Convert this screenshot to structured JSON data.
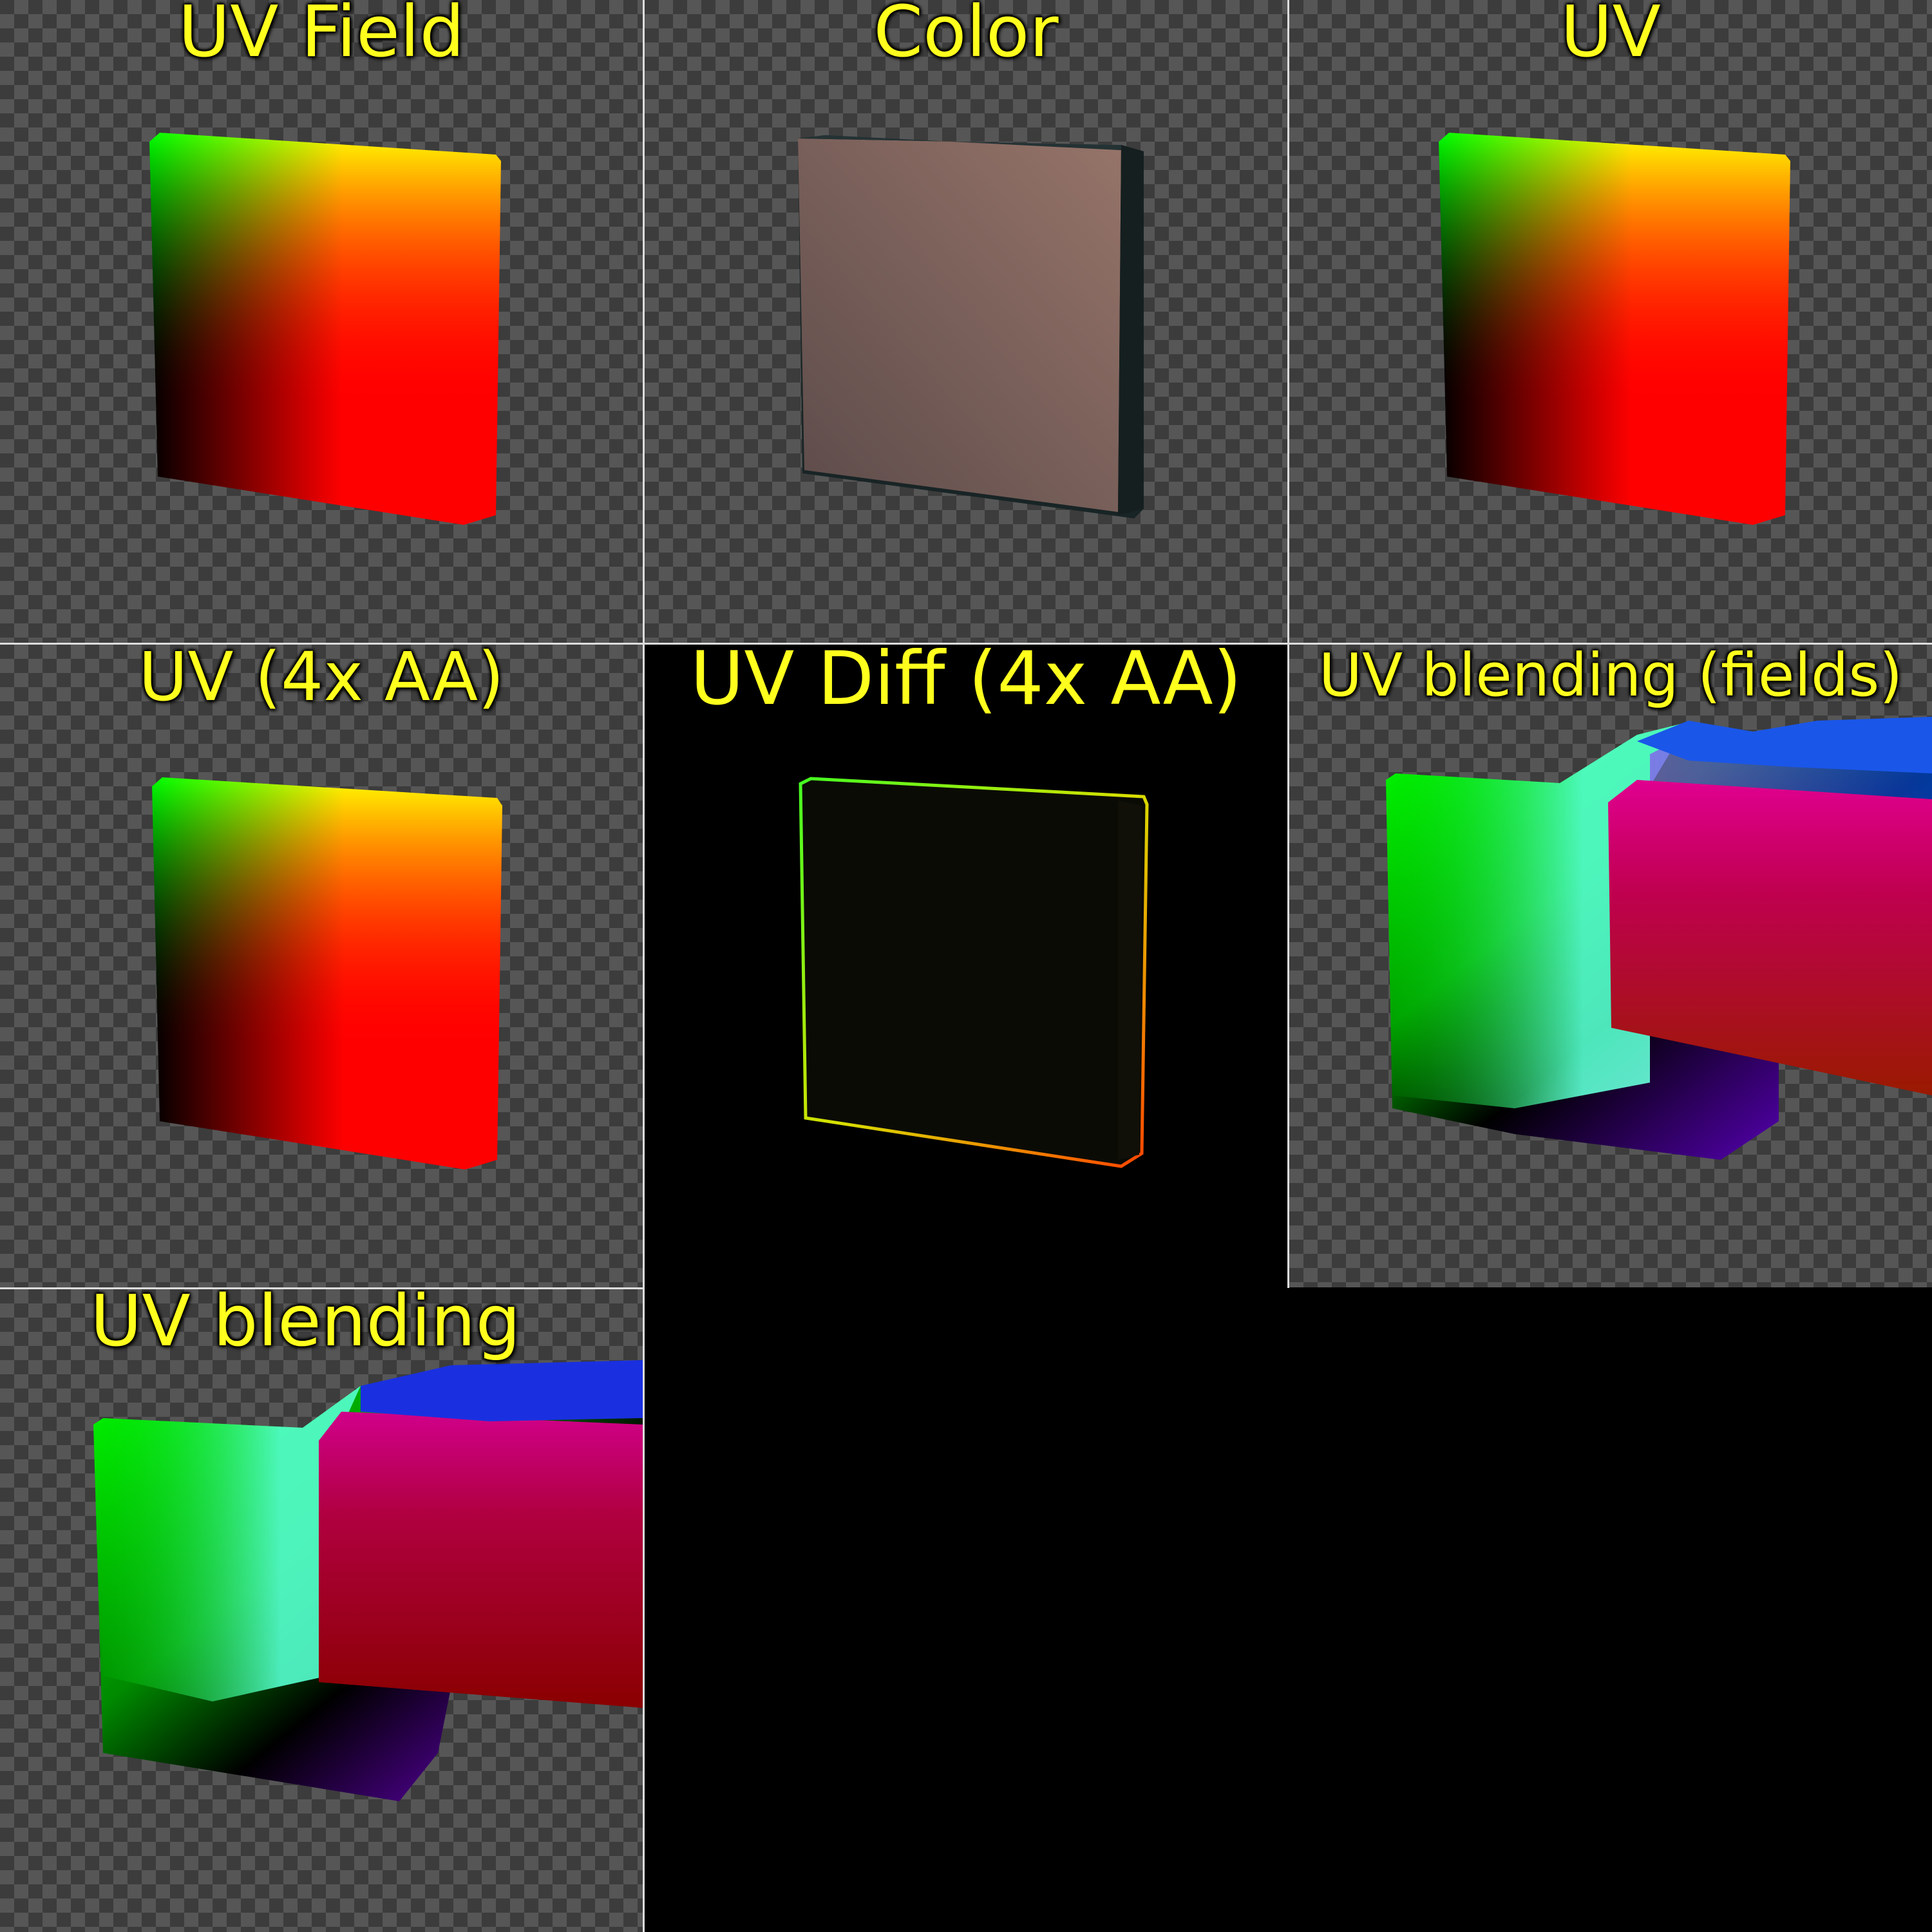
{
  "panels": [
    {
      "title": "UV Field"
    },
    {
      "title": "Color"
    },
    {
      "title": "UV"
    },
    {
      "title": "UV (4x AA)"
    },
    {
      "title": "UV Diff (4x AA)"
    },
    {
      "title": "UV blending (fields)"
    },
    {
      "title": "UV blending"
    },
    {
      "title": ""
    }
  ],
  "colors": {
    "label": "#ffff1e",
    "checker_dark": "#3c3c3c",
    "checker_light": "#565656",
    "divider": "#dcdcdc",
    "box_side": "#182425",
    "box_face": "#8a6f69"
  }
}
